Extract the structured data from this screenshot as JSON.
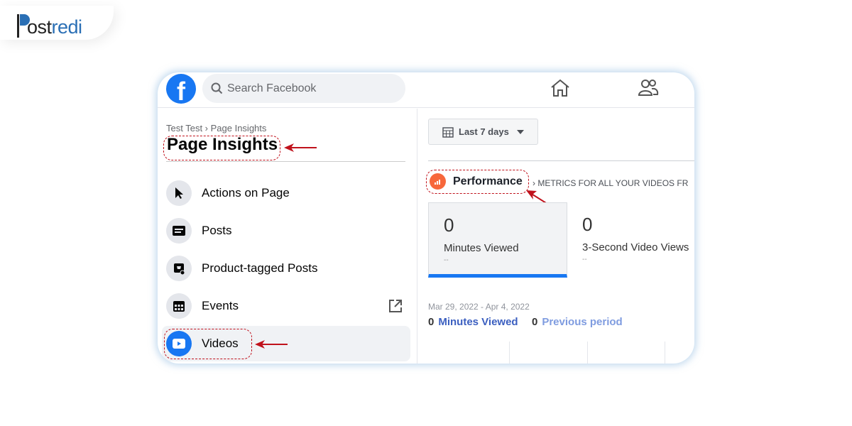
{
  "brand": {
    "logo_text": "Postredi",
    "accent": "#2a6fb5"
  },
  "topbar": {
    "search_placeholder": "Search Facebook",
    "icons": [
      "facebook-logo",
      "home-icon",
      "friends-icon"
    ]
  },
  "sidebar": {
    "breadcrumb": "Test Test › Page Insights",
    "title": "Page Insights",
    "items": [
      {
        "label": "Actions on Page",
        "icon": "cursor-icon"
      },
      {
        "label": "Posts",
        "icon": "posts-icon"
      },
      {
        "label": "Product-tagged Posts",
        "icon": "tag-icon"
      },
      {
        "label": "Events",
        "icon": "calendar-icon"
      },
      {
        "label": "Videos",
        "icon": "video-icon",
        "active": true
      }
    ]
  },
  "main": {
    "date_filter": "Last 7 days",
    "section_title": "Performance",
    "section_subtitle": "METRICS FOR ALL YOUR VIDEOS FR",
    "metrics": [
      {
        "value": "0",
        "label": "Minutes Viewed",
        "delta": "--",
        "selected": true
      },
      {
        "value": "0",
        "label": "3-Second Video Views",
        "delta": "--"
      }
    ],
    "date_range": "Mar 29, 2022 - Apr 4, 2022",
    "legend": [
      {
        "value": "0",
        "label": "Minutes Viewed",
        "color": "#3b5fc0"
      },
      {
        "value": "0",
        "label": "Previous period",
        "color": "#7f9ce0"
      }
    ]
  },
  "colors": {
    "facebook_blue": "#1877f2",
    "annotation_red": "#c0121c",
    "performance_orange": "#f7673b"
  }
}
